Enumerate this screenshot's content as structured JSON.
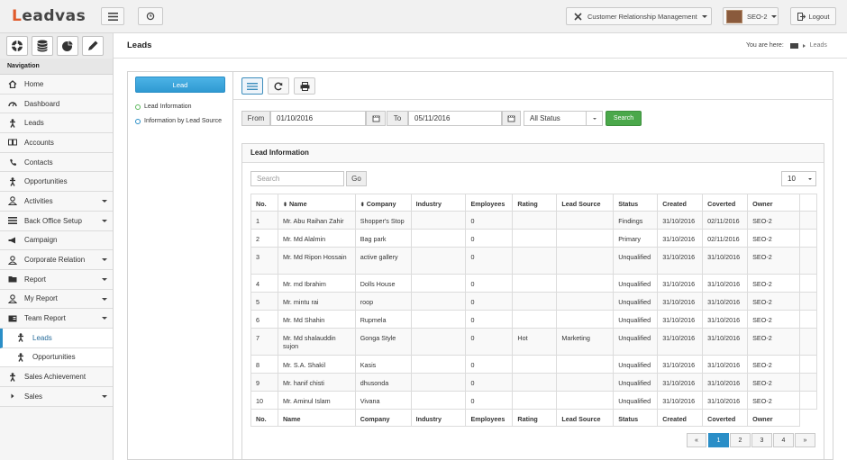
{
  "app": {
    "logo": "Leadvas"
  },
  "topbar": {
    "module": "Customer Relationship Management",
    "user": "SEO-2",
    "logout": "Logout"
  },
  "page": {
    "title": "Leads",
    "breadcrumb_prefix": "You are here:",
    "breadcrumb_current": "Leads"
  },
  "nav": {
    "heading": "Navigation",
    "items": [
      {
        "label": "Home",
        "icon": "home-icon",
        "caret": false
      },
      {
        "label": "Dashboard",
        "icon": "dashboard-icon",
        "caret": false
      },
      {
        "label": "Leads",
        "icon": "person-icon",
        "caret": false
      },
      {
        "label": "Accounts",
        "icon": "book-icon",
        "caret": false
      },
      {
        "label": "Contacts",
        "icon": "phone-icon",
        "caret": false
      },
      {
        "label": "Opportunities",
        "icon": "person-icon",
        "caret": false
      },
      {
        "label": "Activities",
        "icon": "user-icon",
        "caret": true
      },
      {
        "label": "Back Office Setup",
        "icon": "list-icon",
        "caret": true
      },
      {
        "label": "Campaign",
        "icon": "megaphone-icon",
        "caret": false
      },
      {
        "label": "Corporate Relation",
        "icon": "user-icon",
        "caret": true
      },
      {
        "label": "Report",
        "icon": "folder-icon",
        "caret": true
      },
      {
        "label": "My Report",
        "icon": "user-icon",
        "caret": true
      },
      {
        "label": "Team Report",
        "icon": "id-card-icon",
        "caret": true
      }
    ],
    "subitems": [
      {
        "label": "Leads",
        "icon": "person-icon",
        "active": true
      },
      {
        "label": "Opportunities",
        "icon": "person-icon",
        "active": false
      }
    ],
    "after": [
      {
        "label": "Sales Achievement",
        "icon": "person-icon",
        "caret": false
      },
      {
        "label": "Sales",
        "icon": "caret-right-icon",
        "caret": true
      }
    ]
  },
  "left_panel": {
    "button": "Lead",
    "options": [
      {
        "label": "Lead Information",
        "color": "#5cb85c"
      },
      {
        "label": "Information by Lead Source",
        "color": "#2a8ec7"
      }
    ]
  },
  "filters": {
    "from_label": "From",
    "from_value": "01/10/2016",
    "to_label": "To",
    "to_value": "05/11/2016",
    "status_value": "All Status",
    "search_button": "Search"
  },
  "table_panel": {
    "title": "Lead Information",
    "search_placeholder": "Search",
    "go_button": "Go",
    "page_size": "10",
    "columns": [
      "No.",
      "Name",
      "Company",
      "Industry",
      "Employees",
      "Rating",
      "Lead Source",
      "Status",
      "Created",
      "Coverted",
      "Owner"
    ],
    "rows": [
      {
        "no": "1",
        "name": "Mr. Abu Raihan Zahir",
        "company": "Shopper's Stop",
        "industry": "",
        "employees": "0",
        "rating": "",
        "source": "",
        "status": "Findings",
        "created": "31/10/2016",
        "converted": "02/11/2016",
        "owner": "SEO-2"
      },
      {
        "no": "2",
        "name": "Mr. Md Alalmin",
        "company": "Bag park",
        "industry": "",
        "employees": "0",
        "rating": "",
        "source": "",
        "status": "Primary",
        "created": "31/10/2016",
        "converted": "02/11/2016",
        "owner": "SEO-2"
      },
      {
        "no": "3",
        "name": "Mr. Md Ripon Hossain",
        "company": "active gallery",
        "industry": "",
        "employees": "0",
        "rating": "",
        "source": "",
        "status": "Unqualified",
        "created": "31/10/2016",
        "converted": "31/10/2016",
        "owner": "SEO-2"
      },
      {
        "no": "4",
        "name": "Mr. md Ibrahim",
        "company": "Dolls House",
        "industry": "",
        "employees": "0",
        "rating": "",
        "source": "",
        "status": "Unqualified",
        "created": "31/10/2016",
        "converted": "31/10/2016",
        "owner": "SEO-2"
      },
      {
        "no": "5",
        "name": "Mr. mintu rai",
        "company": "roop",
        "industry": "",
        "employees": "0",
        "rating": "",
        "source": "",
        "status": "Unqualified",
        "created": "31/10/2016",
        "converted": "31/10/2016",
        "owner": "SEO-2"
      },
      {
        "no": "6",
        "name": "Mr. Md Shahin",
        "company": "Rupmela",
        "industry": "",
        "employees": "0",
        "rating": "",
        "source": "",
        "status": "Unqualified",
        "created": "31/10/2016",
        "converted": "31/10/2016",
        "owner": "SEO-2"
      },
      {
        "no": "7",
        "name": "Mr. Md shalauddin sujon",
        "company": "Gonga Style",
        "industry": "",
        "employees": "0",
        "rating": "Hot",
        "source": "Marketing",
        "status": "Unqualified",
        "created": "31/10/2016",
        "converted": "31/10/2016",
        "owner": "SEO-2"
      },
      {
        "no": "8",
        "name": "Mr. S.A. Shakil",
        "company": "Kasis",
        "industry": "",
        "employees": "0",
        "rating": "",
        "source": "",
        "status": "Unqualified",
        "created": "31/10/2016",
        "converted": "31/10/2016",
        "owner": "SEO-2"
      },
      {
        "no": "9",
        "name": "Mr. hanif chisti",
        "company": "dhusonda",
        "industry": "",
        "employees": "0",
        "rating": "",
        "source": "",
        "status": "Unqualified",
        "created": "31/10/2016",
        "converted": "31/10/2016",
        "owner": "SEO-2"
      },
      {
        "no": "10",
        "name": "Mr. Aminul Islam",
        "company": "Vivana",
        "industry": "",
        "employees": "0",
        "rating": "",
        "source": "",
        "status": "Unqualified",
        "created": "31/10/2016",
        "converted": "31/10/2016",
        "owner": "SEO-2"
      }
    ]
  },
  "pagination": {
    "prev": "«",
    "pages": [
      "1",
      "2",
      "3",
      "4"
    ],
    "next": "»",
    "current": "1"
  },
  "colors": {
    "accent": "#2a8ec7",
    "search_green": "#4aa84a",
    "lead_button": "#39a3d7"
  }
}
